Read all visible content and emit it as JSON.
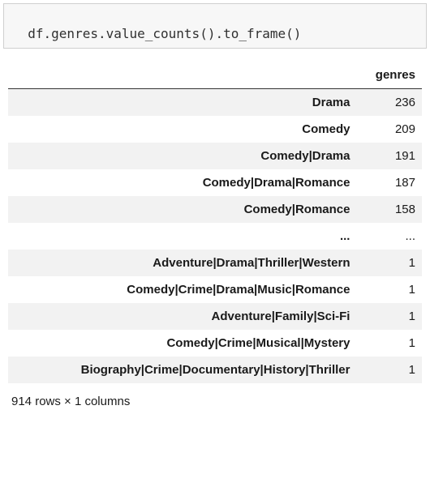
{
  "code": "df.genres.value_counts().to_frame()",
  "table": {
    "column_header": "genres",
    "rows": [
      {
        "label": "Drama",
        "value": "236"
      },
      {
        "label": "Comedy",
        "value": "209"
      },
      {
        "label": "Comedy|Drama",
        "value": "191"
      },
      {
        "label": "Comedy|Drama|Romance",
        "value": "187"
      },
      {
        "label": "Comedy|Romance",
        "value": "158"
      },
      {
        "label": "...",
        "value": "..."
      },
      {
        "label": "Adventure|Drama|Thriller|Western",
        "value": "1"
      },
      {
        "label": "Comedy|Crime|Drama|Music|Romance",
        "value": "1"
      },
      {
        "label": "Adventure|Family|Sci-Fi",
        "value": "1"
      },
      {
        "label": "Comedy|Crime|Musical|Mystery",
        "value": "1"
      },
      {
        "label": "Biography|Crime|Documentary|History|Thriller",
        "value": "1"
      }
    ]
  },
  "shape_text": "914 rows × 1 columns"
}
